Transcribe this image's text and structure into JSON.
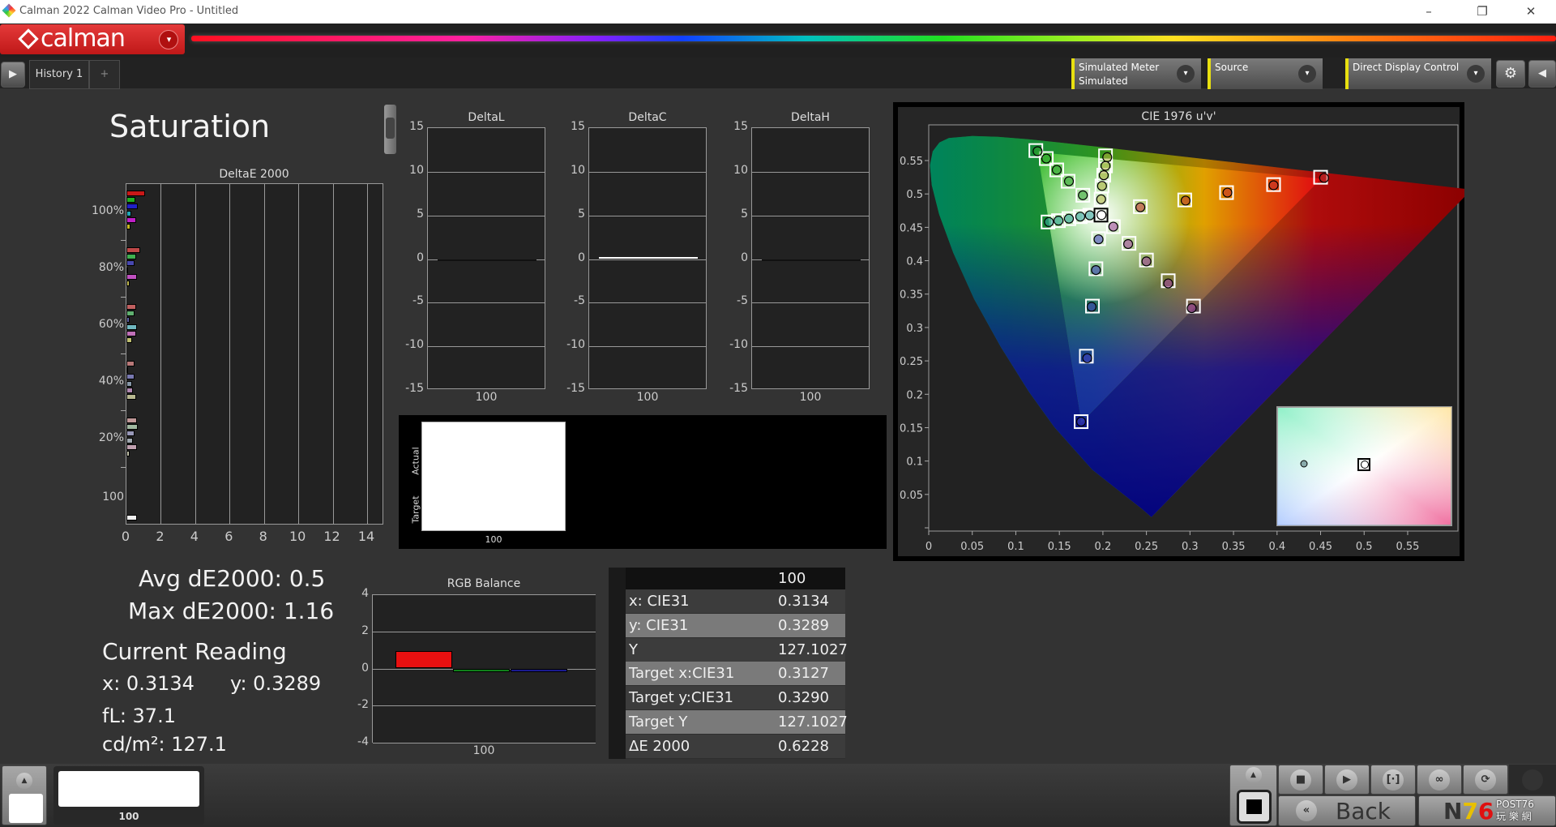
{
  "window": {
    "title": "Calman 2022 Calman Video Pro  - Untitled",
    "minimize": "–",
    "restore": "❐",
    "close": "✕"
  },
  "brand": {
    "logo_text": "calman",
    "menu_icon": "▾"
  },
  "toolbar": {
    "history_tab": "History 1",
    "add_tab": "+",
    "play_icon": "▶",
    "collapse_icon": "◀",
    "meter": {
      "label": "Simulated Meter",
      "value": "Simulated"
    },
    "source": {
      "label": "Source"
    },
    "display": {
      "label": "Direct Display Control"
    },
    "chevron": "▾",
    "settings_icon": "⚙",
    "accent": "#e8e010"
  },
  "page": {
    "title": "Saturation"
  },
  "stats": {
    "avg": "Avg dE2000: 0.5",
    "max": "Max dE2000: 1.16",
    "current_heading": "Current Reading",
    "x": "x: 0.3134",
    "y": "y: 0.3289",
    "fl": "fL: 37.1",
    "cdm2": "cd/m²: 127.1"
  },
  "swatch": {
    "actual_label": "Actual",
    "target_label": "Target",
    "point_label": "100"
  },
  "table": {
    "header": "100",
    "rows": [
      {
        "label": "x: CIE31",
        "value": "0.3134"
      },
      {
        "label": "y: CIE31",
        "value": "0.3289"
      },
      {
        "label": "Y",
        "value": "127.1027"
      },
      {
        "label": "Target x:CIE31",
        "value": "0.3127"
      },
      {
        "label": "Target y:CIE31",
        "value": "0.3290"
      },
      {
        "label": "Target Y",
        "value": "127.1027"
      },
      {
        "label": "ΔE 2000",
        "value": "0.6228"
      }
    ]
  },
  "bottom": {
    "thumb_label": "100",
    "back_label": "Back",
    "back_icon": "«",
    "watermark": "N76 POST76 玩樂網",
    "controls": [
      "stop",
      "play",
      "fit",
      "loop",
      "refresh"
    ],
    "control_glyphs": [
      "■",
      "▶",
      "[·]",
      "∞",
      "⟳"
    ],
    "up_icon": "▲"
  },
  "chart_data": [
    {
      "type": "bar",
      "orientation": "horizontal",
      "title": "DeltaE 2000",
      "categories": [
        "100%",
        "80%",
        "60%",
        "40%",
        "20%",
        "100"
      ],
      "xlim": [
        0,
        15
      ],
      "xticks": [
        "0",
        "2",
        "4",
        "6",
        "8",
        "10",
        "12",
        "14"
      ],
      "grid": true,
      "groups": [
        {
          "values": [
            1.1,
            0.5,
            0.65,
            0.3,
            0.55,
            0.25
          ],
          "colors": [
            "#c81818",
            "#20b020",
            "#2020c8",
            "#20a8b8",
            "#c020c8",
            "#c8b820"
          ]
        },
        {
          "values": [
            0.8,
            0.55,
            0.45,
            0.05,
            0.6,
            0.2
          ],
          "colors": [
            "#c04848",
            "#40b050",
            "#4848b0",
            "#40a8b8",
            "#c050c0",
            "#c0b850"
          ]
        },
        {
          "values": [
            0.55,
            0.45,
            0.2,
            0.6,
            0.55,
            0.35
          ],
          "colors": [
            "#c06060",
            "#60b070",
            "#6060a8",
            "#70b8c0",
            "#c070b8",
            "#c0c070"
          ]
        },
        {
          "values": [
            0.45,
            0.1,
            0.45,
            0.35,
            0.4,
            0.55
          ],
          "colors": [
            "#b87878",
            "#80a890",
            "#7878b0",
            "#8898a8",
            "#b088b0",
            "#b8b890"
          ]
        },
        {
          "values": [
            0.6,
            0.65,
            0.45,
            0.4,
            0.6,
            0.2
          ],
          "colors": [
            "#c09898",
            "#a0b8a0",
            "#9898b8",
            "#a0a8b0",
            "#c0a0b0",
            "#c0c0a8"
          ]
        },
        {
          "values": [
            0.6
          ],
          "colors": [
            "#f0f0f0"
          ]
        }
      ]
    },
    {
      "type": "bar",
      "title": "DeltaL",
      "categories": [
        "100"
      ],
      "values": [
        0
      ],
      "ylim": [
        -15,
        15
      ],
      "yticks": [
        "15",
        "10",
        "5",
        "0",
        "-5",
        "-10",
        "-15"
      ],
      "color": "#111111"
    },
    {
      "type": "bar",
      "title": "DeltaC",
      "categories": [
        "100"
      ],
      "values": [
        0.2
      ],
      "ylim": [
        -15,
        15
      ],
      "yticks": [
        "15",
        "10",
        "5",
        "0",
        "-5",
        "-10",
        "-15"
      ],
      "color": "#ffffff"
    },
    {
      "type": "bar",
      "title": "DeltaH",
      "categories": [
        "100"
      ],
      "values": [
        0
      ],
      "ylim": [
        -15,
        15
      ],
      "yticks": [
        "15",
        "10",
        "5",
        "0",
        "-5",
        "-10",
        "-15"
      ],
      "color": "#111111"
    },
    {
      "type": "bar",
      "title": "RGB Balance",
      "categories": [
        "100"
      ],
      "ylim": [
        -4,
        4
      ],
      "yticks": [
        "4",
        "2",
        "0",
        "-2",
        "-4"
      ],
      "series": [
        {
          "value": 0.95,
          "color": "#e81010"
        },
        {
          "value": -0.2,
          "color": "#10801a"
        },
        {
          "value": -0.2,
          "color": "#1a1a90"
        }
      ]
    },
    {
      "type": "scatter",
      "title": "CIE 1976 u'v'",
      "xlim": [
        0,
        0.608
      ],
      "ylim": [
        0,
        0.603
      ],
      "xticks": [
        "0",
        "0.05",
        "0.1",
        "0.15",
        "0.2",
        "0.25",
        "0.3",
        "0.35",
        "0.4",
        "0.45",
        "0.5",
        "0.55"
      ],
      "yticks": [
        "0.05",
        "0.1",
        "0.15",
        "0.2",
        "0.25",
        "0.3",
        "0.35",
        "0.4",
        "0.45",
        "0.5",
        "0.55"
      ],
      "series": [
        {
          "color": "#30a030",
          "targets": [
            [
              0.123,
              0.565
            ],
            [
              0.135,
              0.553
            ],
            [
              0.147,
              0.536
            ],
            [
              0.16,
              0.519
            ],
            [
              0.177,
              0.498
            ]
          ],
          "measured": [
            [
              0.125,
              0.564
            ],
            [
              0.135,
              0.553
            ],
            [
              0.147,
              0.536
            ],
            [
              0.161,
              0.519
            ],
            [
              0.177,
              0.498
            ]
          ]
        },
        {
          "color": "#30a0a0",
          "targets": [
            [
              0.137,
              0.458
            ],
            [
              0.149,
              0.46
            ],
            [
              0.161,
              0.463
            ],
            [
              0.174,
              0.466
            ],
            [
              0.185,
              0.468
            ]
          ],
          "measured": [
            [
              0.138,
              0.458
            ],
            [
              0.149,
              0.46
            ],
            [
              0.161,
              0.463
            ],
            [
              0.174,
              0.466
            ],
            [
              0.185,
              0.468
            ]
          ]
        },
        {
          "color": "#b0b040",
          "targets": [
            [
              0.203,
              0.557
            ],
            [
              0.203,
              0.542
            ],
            [
              0.201,
              0.528
            ],
            [
              0.199,
              0.512
            ],
            [
              0.198,
              0.492
            ]
          ],
          "measured": [
            [
              0.205,
              0.555
            ],
            [
              0.203,
              0.542
            ],
            [
              0.201,
              0.528
            ],
            [
              0.199,
              0.512
            ],
            [
              0.198,
              0.492
            ]
          ]
        },
        {
          "color": "#c03030",
          "targets": [
            [
              0.45,
              0.525
            ],
            [
              0.396,
              0.514
            ],
            [
              0.342,
              0.502
            ],
            [
              0.294,
              0.491
            ],
            [
              0.243,
              0.481
            ]
          ],
          "measured": [
            [
              0.454,
              0.524
            ],
            [
              0.396,
              0.513
            ],
            [
              0.343,
              0.502
            ],
            [
              0.295,
              0.49
            ],
            [
              0.243,
              0.48
            ]
          ]
        },
        {
          "color": "#4040c0",
          "targets": [
            [
              0.175,
              0.159
            ],
            [
              0.181,
              0.257
            ],
            [
              0.188,
              0.332
            ],
            [
              0.192,
              0.388
            ],
            [
              0.195,
              0.433
            ]
          ],
          "measured": [
            [
              0.175,
              0.159
            ],
            [
              0.182,
              0.254
            ],
            [
              0.187,
              0.331
            ],
            [
              0.192,
              0.386
            ],
            [
              0.195,
              0.432
            ]
          ]
        },
        {
          "color": "#a040a0",
          "targets": [
            [
              0.304,
              0.332
            ],
            [
              0.275,
              0.37
            ],
            [
              0.25,
              0.401
            ],
            [
              0.23,
              0.426
            ],
            [
              0.212,
              0.451
            ]
          ],
          "measured": [
            [
              0.302,
              0.329
            ],
            [
              0.275,
              0.366
            ],
            [
              0.25,
              0.399
            ],
            [
              0.229,
              0.425
            ],
            [
              0.212,
              0.451
            ]
          ]
        },
        {
          "color": "#ffffff",
          "targets": [
            [
              0.1978,
              0.4683
            ]
          ],
          "measured": [
            [
              0.1984,
              0.4684
            ]
          ]
        }
      ]
    }
  ]
}
